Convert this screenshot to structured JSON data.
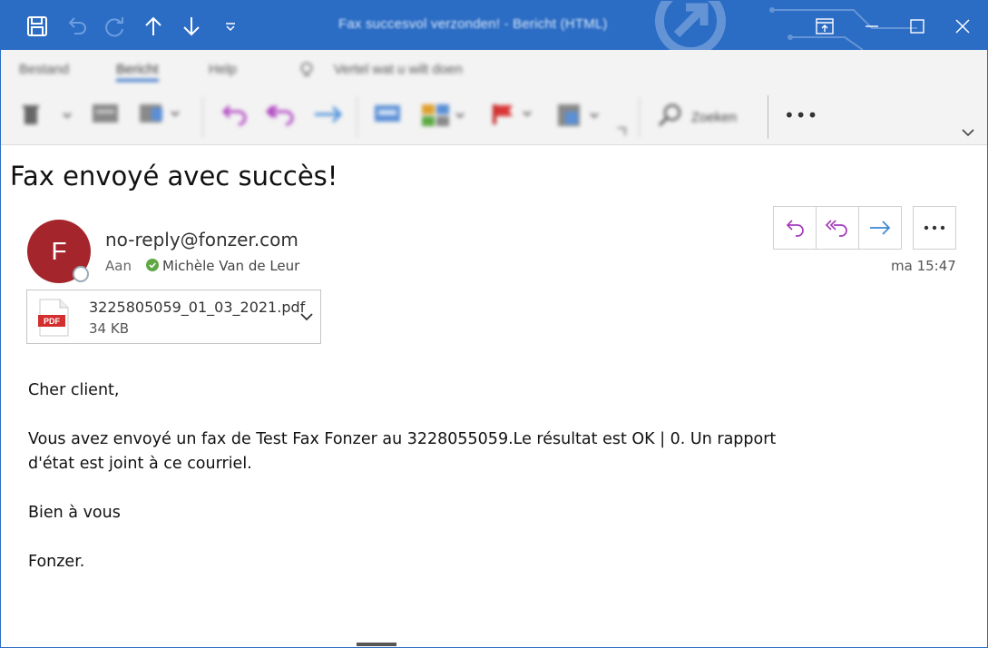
{
  "titlebar": {
    "title": "Fax succesvol verzonden! - Bericht (HTML)",
    "accent_color": "#2b6cc4",
    "quick_access": [
      "save-icon",
      "undo-icon",
      "redo-icon",
      "arrow-up-icon",
      "arrow-down-icon",
      "customize-dropdown-icon"
    ],
    "window_controls": [
      "restore-ribbon-icon",
      "minimize-icon",
      "maximize-icon",
      "close-icon"
    ]
  },
  "ribbon": {
    "tabs": [
      {
        "label": "Bestand"
      },
      {
        "label": "Bericht",
        "active": true
      },
      {
        "label": "Help"
      }
    ],
    "tell_me": "Vertel wat u wilt doen",
    "search_label": "Zoeken"
  },
  "message": {
    "subject": "Fax envoyé avec succès!",
    "avatar_initial": "F",
    "avatar_color": "#a4262c",
    "sender": "no-reply@fonzer.com",
    "to_label": "Aan",
    "recipient": "Michèle Van de Leur",
    "time": "ma 15:47",
    "attachment": {
      "name": "3225805059_01_03_2021.pdf",
      "size": "34 KB",
      "badge": "PDF"
    },
    "body": {
      "greeting": "Cher client,",
      "line1": "Vous avez envoyé un fax de Test Fax Fonzer au 3228055059.Le résultat est OK | 0. Un rapport",
      "line2": "d'état est joint à ce courriel.",
      "closing": "Bien à vous",
      "signature": "Fonzer."
    }
  }
}
